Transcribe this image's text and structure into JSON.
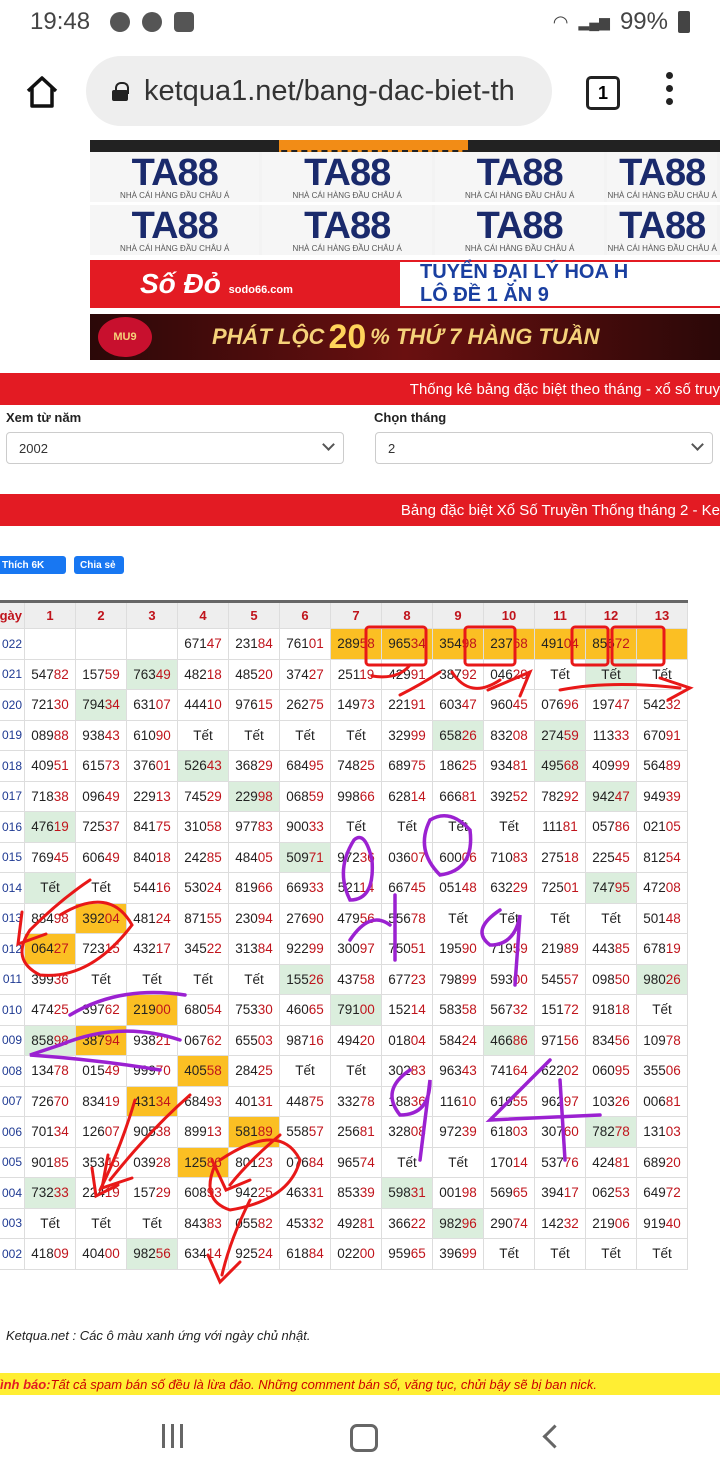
{
  "status": {
    "time": "19:48",
    "battery": "99%"
  },
  "browser": {
    "url": "ketqua1.net/bang-dac-biet-th",
    "tab_count": "1"
  },
  "ads": {
    "ta88_brand": "TA88",
    "ta88_sub": "NHÀ CÁI HÀNG ĐẦU CHÂU Á",
    "sodo_left": "Số Đỏ",
    "sodo_right_1": "TUYỂN ĐẠI LÝ  HOA H",
    "sodo_right_2": "LÔ ĐỀ  1 ĂN 9",
    "sodo_site": "sodo66.com",
    "phat_logo": "MU9",
    "phat_text": "PHÁT LỘC",
    "phat_pct": "20",
    "phat_rest": "% THỨ 7 HÀNG TUẦN"
  },
  "header1": "Thống kê bảng đặc biệt theo tháng - xổ số truy",
  "filters": {
    "year_label": "Xem từ năm",
    "year_value": "2002",
    "month_label": "Chọn tháng",
    "month_value": "2"
  },
  "header2": "Bảng đặc biệt Xổ Số Truyền Thống tháng 2 - Ke",
  "social": {
    "like": "Thích 6K",
    "share": "Chia sẻ"
  },
  "table": {
    "corner": "gày",
    "days": [
      "1",
      "2",
      "3",
      "4",
      "5",
      "6",
      "7",
      "8",
      "9",
      "10",
      "11",
      "12",
      "13"
    ],
    "rows": [
      {
        "year": "022",
        "cells": [
          "",
          "",
          "",
          "67147",
          "23184",
          "76101",
          "28958",
          "96534",
          "35498",
          "23768",
          "49104",
          "85672",
          ""
        ]
      },
      {
        "year": "021",
        "cells": [
          "54782",
          "15759",
          "76349",
          "48218",
          "48520",
          "37427",
          "25119",
          "42991",
          "38792",
          "04629",
          "Tết",
          "Tết",
          "Tết"
        ]
      },
      {
        "year": "020",
        "cells": [
          "72130",
          "79434",
          "63107",
          "44410",
          "97615",
          "26275",
          "14973",
          "22191",
          "60347",
          "96045",
          "07696",
          "19747",
          "54232"
        ]
      },
      {
        "year": "019",
        "cells": [
          "08988",
          "93843",
          "61090",
          "Tết",
          "Tết",
          "Tết",
          "Tết",
          "32999",
          "65826",
          "83208",
          "27459",
          "11333",
          "67091"
        ]
      },
      {
        "year": "018",
        "cells": [
          "40951",
          "61573",
          "37601",
          "52643",
          "36829",
          "68495",
          "74825",
          "68975",
          "18625",
          "93481",
          "49568",
          "40999",
          "56489"
        ]
      },
      {
        "year": "017",
        "cells": [
          "71838",
          "09649",
          "22913",
          "74529",
          "22998",
          "06859",
          "99866",
          "62814",
          "66681",
          "39252",
          "78292",
          "94247",
          "94939"
        ]
      },
      {
        "year": "016",
        "cells": [
          "47619",
          "72537",
          "84175",
          "31058",
          "97783",
          "90033",
          "Tết",
          "Tết",
          "Tết",
          "Tết",
          "11181",
          "05786",
          "02105"
        ]
      },
      {
        "year": "015",
        "cells": [
          "76945",
          "60649",
          "84018",
          "24285",
          "48405",
          "50971",
          "97236",
          "03607",
          "60006",
          "71083",
          "27518",
          "22545",
          "81254"
        ]
      },
      {
        "year": "014",
        "cells": [
          "Tết",
          "Tết",
          "54416",
          "53024",
          "81966",
          "66933",
          "52114",
          "66745",
          "05148",
          "63229",
          "72501",
          "74795",
          "47208"
        ]
      },
      {
        "year": "013",
        "cells": [
          "88498",
          "39204",
          "48124",
          "87155",
          "23094",
          "27690",
          "47956",
          "55678",
          "Tết",
          "Tết",
          "Tết",
          "Tết",
          "50148"
        ]
      },
      {
        "year": "012",
        "cells": [
          "06427",
          "72315",
          "43217",
          "34522",
          "31384",
          "92299",
          "30097",
          "75051",
          "19590",
          "71959",
          "21989",
          "44385",
          "67819"
        ]
      },
      {
        "year": "011",
        "cells": [
          "39936",
          "Tết",
          "Tết",
          "Tết",
          "Tết",
          "15526",
          "43758",
          "67723",
          "79899",
          "59300",
          "54557",
          "09850",
          "98026"
        ]
      },
      {
        "year": "010",
        "cells": [
          "47425",
          "39762",
          "21900",
          "68054",
          "75330",
          "46065",
          "79100",
          "15214",
          "58358",
          "56732",
          "15172",
          "91818",
          "Tết"
        ]
      },
      {
        "year": "009",
        "cells": [
          "85898",
          "38794",
          "93821",
          "06762",
          "65503",
          "98716",
          "49420",
          "01804",
          "58424",
          "46686",
          "97156",
          "83456",
          "10978"
        ]
      },
      {
        "year": "008",
        "cells": [
          "13478",
          "01549",
          "99970",
          "40558",
          "28425",
          "Tết",
          "Tết",
          "30283",
          "96343",
          "74164",
          "62202",
          "06095",
          "35506"
        ]
      },
      {
        "year": "007",
        "cells": [
          "72670",
          "83419",
          "43134",
          "68493",
          "40131",
          "44875",
          "33278",
          "18836",
          "11610",
          "61955",
          "96297",
          "10326",
          "00681"
        ]
      },
      {
        "year": "006",
        "cells": [
          "70134",
          "12607",
          "90538",
          "89913",
          "58189",
          "55857",
          "25681",
          "32808",
          "97239",
          "61803",
          "30760",
          "78278",
          "13103"
        ]
      },
      {
        "year": "005",
        "cells": [
          "90185",
          "35345",
          "03928",
          "12586",
          "80123",
          "07684",
          "96574",
          "Tết",
          "Tết",
          "17014",
          "53776",
          "42481",
          "68920"
        ]
      },
      {
        "year": "004",
        "cells": [
          "73233",
          "22419",
          "15729",
          "60893",
          "94225",
          "46331",
          "85339",
          "59831",
          "00198",
          "56965",
          "39417",
          "06253",
          "64972"
        ]
      },
      {
        "year": "003",
        "cells": [
          "Tết",
          "Tết",
          "Tết",
          "84383",
          "05582",
          "45332",
          "49281",
          "36622",
          "98296",
          "29074",
          "14232",
          "21906",
          "91940"
        ]
      },
      {
        "year": "002",
        "cells": [
          "41809",
          "40400",
          "98256",
          "63414",
          "92524",
          "61884",
          "02200",
          "95965",
          "39699",
          "Tết",
          "Tết",
          "Tết",
          "Tết"
        ]
      }
    ]
  },
  "note": "Ketqua.net : Các ô màu xanh ứng với ngày chủ nhật.",
  "warning_label": "ình báo:",
  "warning_text": " Tất cả spam bán số đều là lừa đảo. Những comment bán số, văng tục, chửi bậy sẽ bị ban nick."
}
